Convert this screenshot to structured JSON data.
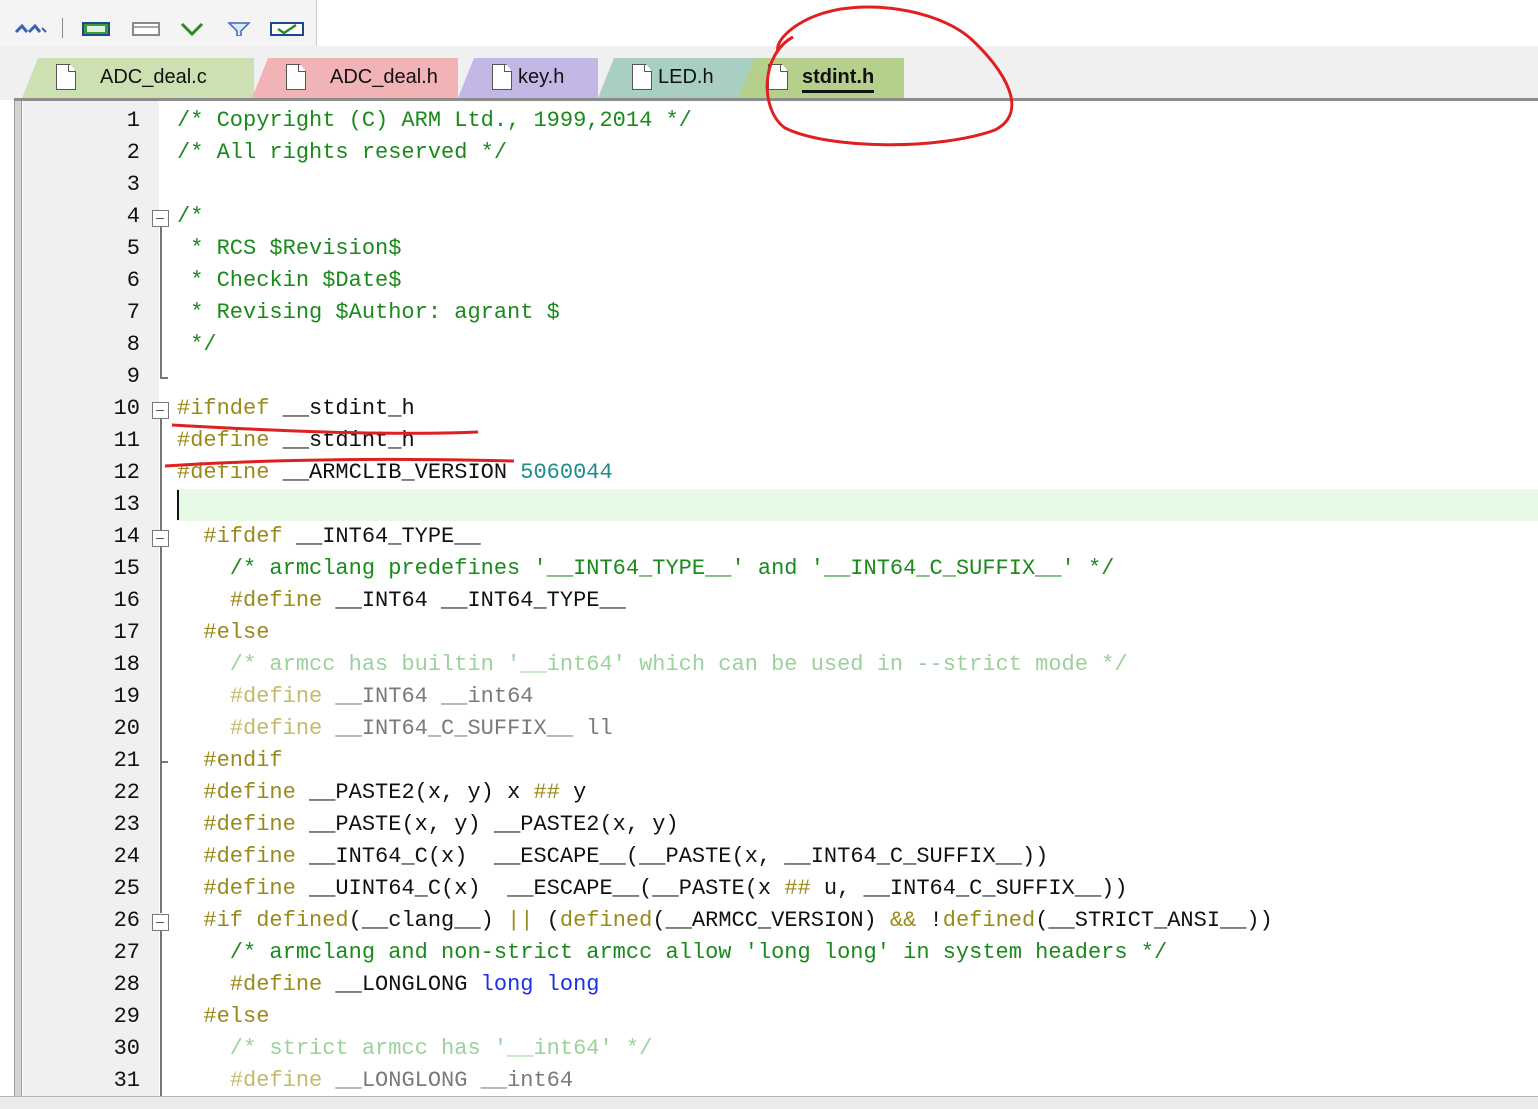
{
  "tabs": [
    {
      "label": "ADC_deal.c",
      "color": "#cde0b2",
      "active": false
    },
    {
      "label": "ADC_deal.h",
      "color": "#f1b3b5",
      "active": false
    },
    {
      "label": "key.h",
      "color": "#c3b7e6",
      "active": false
    },
    {
      "label": "LED.h",
      "color": "#a9cfc3",
      "active": false
    },
    {
      "label": "stdint.h",
      "color": "#b5cf8c",
      "active": true
    }
  ],
  "toolbar_icons": [
    "binoculars-icon",
    "window-icon",
    "window-outline-icon",
    "download-icon",
    "filter-icon",
    "check-window-icon"
  ],
  "editor": {
    "current_line": "13",
    "lines": [
      {
        "n": "1",
        "code": "/* Copyright (C) ARM Ltd., 1999,2014 */"
      },
      {
        "n": "2",
        "code": "/* All rights reserved */"
      },
      {
        "n": "3",
        "code": ""
      },
      {
        "n": "4",
        "code": "/*"
      },
      {
        "n": "5",
        "code": " * RCS $Revision$"
      },
      {
        "n": "6",
        "code": " * Checkin $Date$"
      },
      {
        "n": "7",
        "code": " * Revising $Author: agrant $"
      },
      {
        "n": "8",
        "code": " */"
      },
      {
        "n": "9",
        "code": ""
      },
      {
        "n": "10",
        "code": "#ifndef __stdint_h"
      },
      {
        "n": "11",
        "code": "#define __stdint_h"
      },
      {
        "n": "12",
        "code": "#define __ARMCLIB_VERSION 5060044"
      },
      {
        "n": "13",
        "code": ""
      },
      {
        "n": "14",
        "code": "  #ifdef __INT64_TYPE__"
      },
      {
        "n": "15",
        "code": "    /* armclang predefines '__INT64_TYPE__' and '__INT64_C_SUFFIX__' */"
      },
      {
        "n": "16",
        "code": "    #define __INT64 __INT64_TYPE__"
      },
      {
        "n": "17",
        "code": "  #else"
      },
      {
        "n": "18",
        "code": "    /* armcc has builtin '__int64' which can be used in --strict mode */"
      },
      {
        "n": "19",
        "code": "    #define __INT64 __int64"
      },
      {
        "n": "20",
        "code": "    #define __INT64_C_SUFFIX__ ll"
      },
      {
        "n": "21",
        "code": "  #endif"
      },
      {
        "n": "22",
        "code": "  #define __PASTE2(x, y) x ## y"
      },
      {
        "n": "23",
        "code": "  #define __PASTE(x, y) __PASTE2(x, y)"
      },
      {
        "n": "24",
        "code": "  #define __INT64_C(x)  __ESCAPE__(__PASTE(x, __INT64_C_SUFFIX__))"
      },
      {
        "n": "25",
        "code": "  #define __UINT64_C(x)  __ESCAPE__(__PASTE(x ## u, __INT64_C_SUFFIX__))"
      },
      {
        "n": "26",
        "code": "  #if defined(__clang__) || (defined(__ARMCC_VERSION) && !defined(__STRICT_ANSI__))"
      },
      {
        "n": "27",
        "code": "    /* armclang and non-strict armcc allow 'long long' in system headers */"
      },
      {
        "n": "28",
        "code": "    #define __LONGLONG long long"
      },
      {
        "n": "29",
        "code": "  #else"
      },
      {
        "n": "30",
        "code": "    /* strict armcc has '__int64' */"
      },
      {
        "n": "31",
        "code": "    #define __LONGLONG __int64"
      }
    ]
  }
}
